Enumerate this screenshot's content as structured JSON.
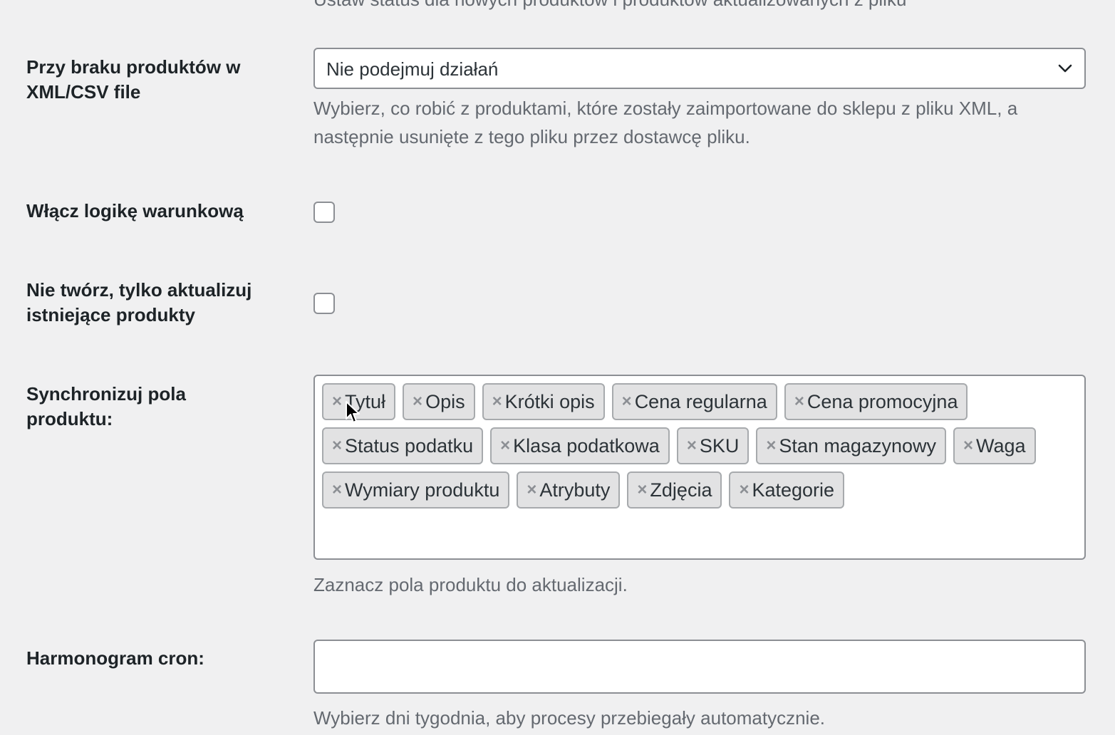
{
  "top_cut_text": "Ustaw status dla nowych produktów i produktów aktualizowanych z pliku",
  "missing_products": {
    "label": "Przy braku produktów w XML/CSV file",
    "selected": "Nie podejmuj działań",
    "description": "Wybierz, co robić z produktami, które zostały zaimportowane do sklepu z pliku XML, a następnie usunięte z tego pliku przez dostawcę pliku."
  },
  "conditional_logic": {
    "label": "Włącz logikę warunkową",
    "checked": false
  },
  "update_only": {
    "label": "Nie twórz, tylko aktualizuj istniejące produkty",
    "checked": false
  },
  "sync_fields": {
    "label": "Synchronizuj pola produktu:",
    "remove_symbol": "×",
    "tags": [
      "Tytuł",
      "Opis",
      "Krótki opis",
      "Cena regularna",
      "Cena promocyjna",
      "Status podatku",
      "Klasa podatkowa",
      "SKU",
      "Stan magazynowy",
      "Waga",
      "Wymiary produktu",
      "Atrybuty",
      "Zdjęcia",
      "Kategorie"
    ],
    "description": "Zaznacz pola produktu do aktualizacji."
  },
  "cron_schedule": {
    "label": "Harmonogram cron:",
    "value": "",
    "description": "Wybierz dni tygodnia, aby procesy przebiegały automatycznie."
  },
  "icons": {
    "select_arrow": "chevron-down-icon",
    "tag_remove": "close-icon",
    "pointer": "mouse-cursor-icon"
  },
  "colors": {
    "background": "#f0f0f1",
    "field_border": "#8c8f94",
    "tag_background": "#e2e2e3",
    "description_text": "#646970"
  }
}
